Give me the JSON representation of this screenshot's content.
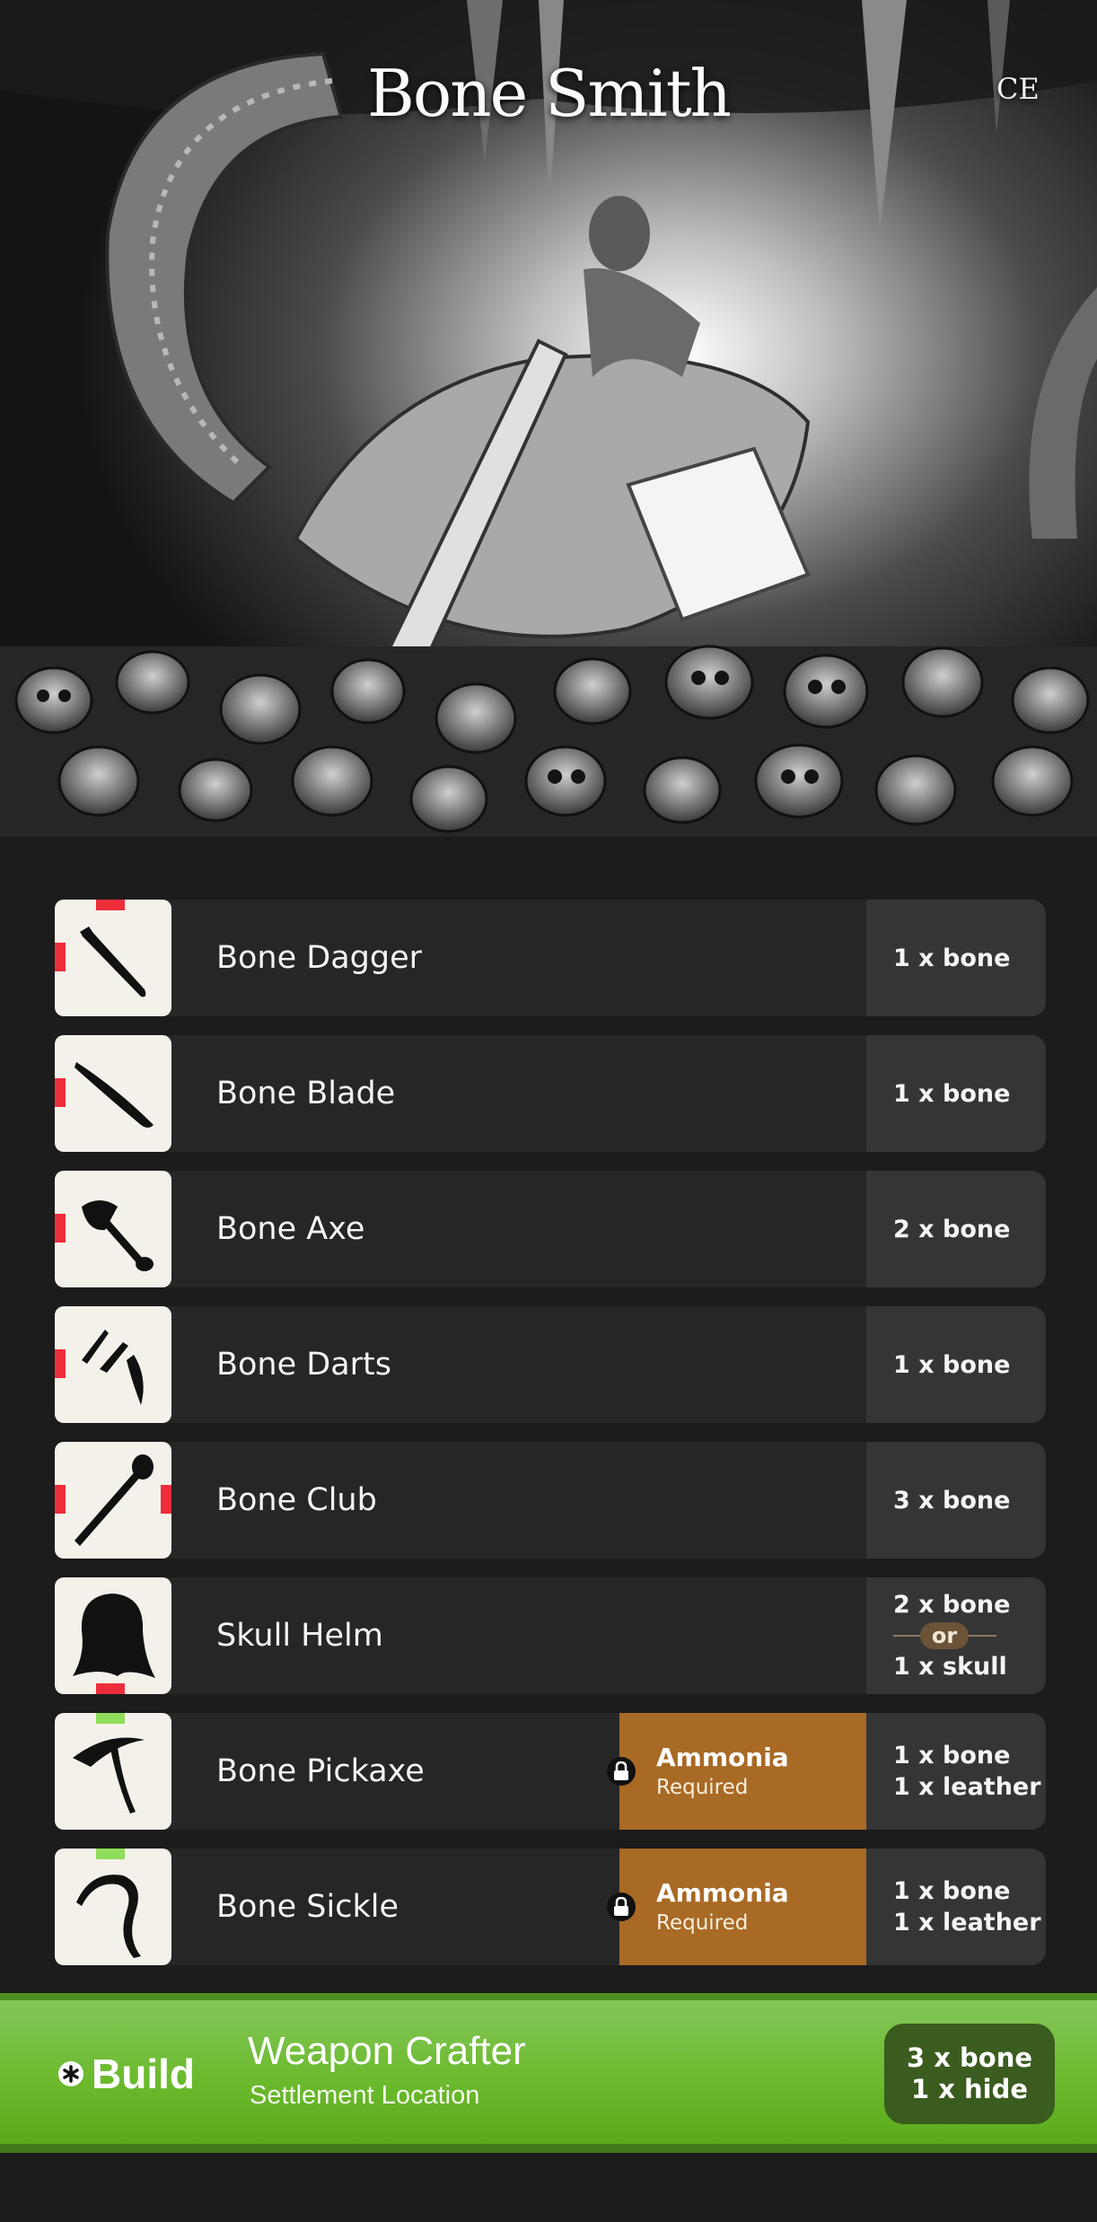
{
  "header": {
    "title": "Bone Smith",
    "expansion": "CE"
  },
  "gear": [
    {
      "name": "Bone Dagger",
      "icon": "dagger-icon",
      "cost": [
        "1 x bone"
      ]
    },
    {
      "name": "Bone Blade",
      "icon": "blade-icon",
      "cost": [
        "1 x bone"
      ]
    },
    {
      "name": "Bone Axe",
      "icon": "axe-icon",
      "cost": [
        "2 x bone"
      ]
    },
    {
      "name": "Bone Darts",
      "icon": "darts-icon",
      "cost": [
        "1 x bone"
      ]
    },
    {
      "name": "Bone Club",
      "icon": "club-icon",
      "cost": [
        "3 x bone"
      ]
    },
    {
      "name": "Skull Helm",
      "icon": "helm-icon",
      "cost": [
        "2 x bone",
        "1 x skull"
      ],
      "or_label": "or"
    },
    {
      "name": "Bone Pickaxe",
      "icon": "pickaxe-icon",
      "requirement": "Ammonia",
      "requirement_status": "Required",
      "cost": [
        "1 x bone",
        "1 x leather"
      ]
    },
    {
      "name": "Bone Sickle",
      "icon": "sickle-icon",
      "requirement": "Ammonia",
      "requirement_status": "Required",
      "cost": [
        "1 x bone",
        "1 x leather"
      ]
    }
  ],
  "build": {
    "button_label": "Build",
    "location_name": "Weapon Crafter",
    "location_subtitle": "Settlement Location",
    "cost": [
      "3 x bone",
      "1 x hide"
    ]
  },
  "colors": {
    "affinity_red": "#ee2d3a",
    "affinity_green": "#8fdd5a",
    "requirement_bg": "#a86a25",
    "build_bar": "#6cba2e"
  }
}
